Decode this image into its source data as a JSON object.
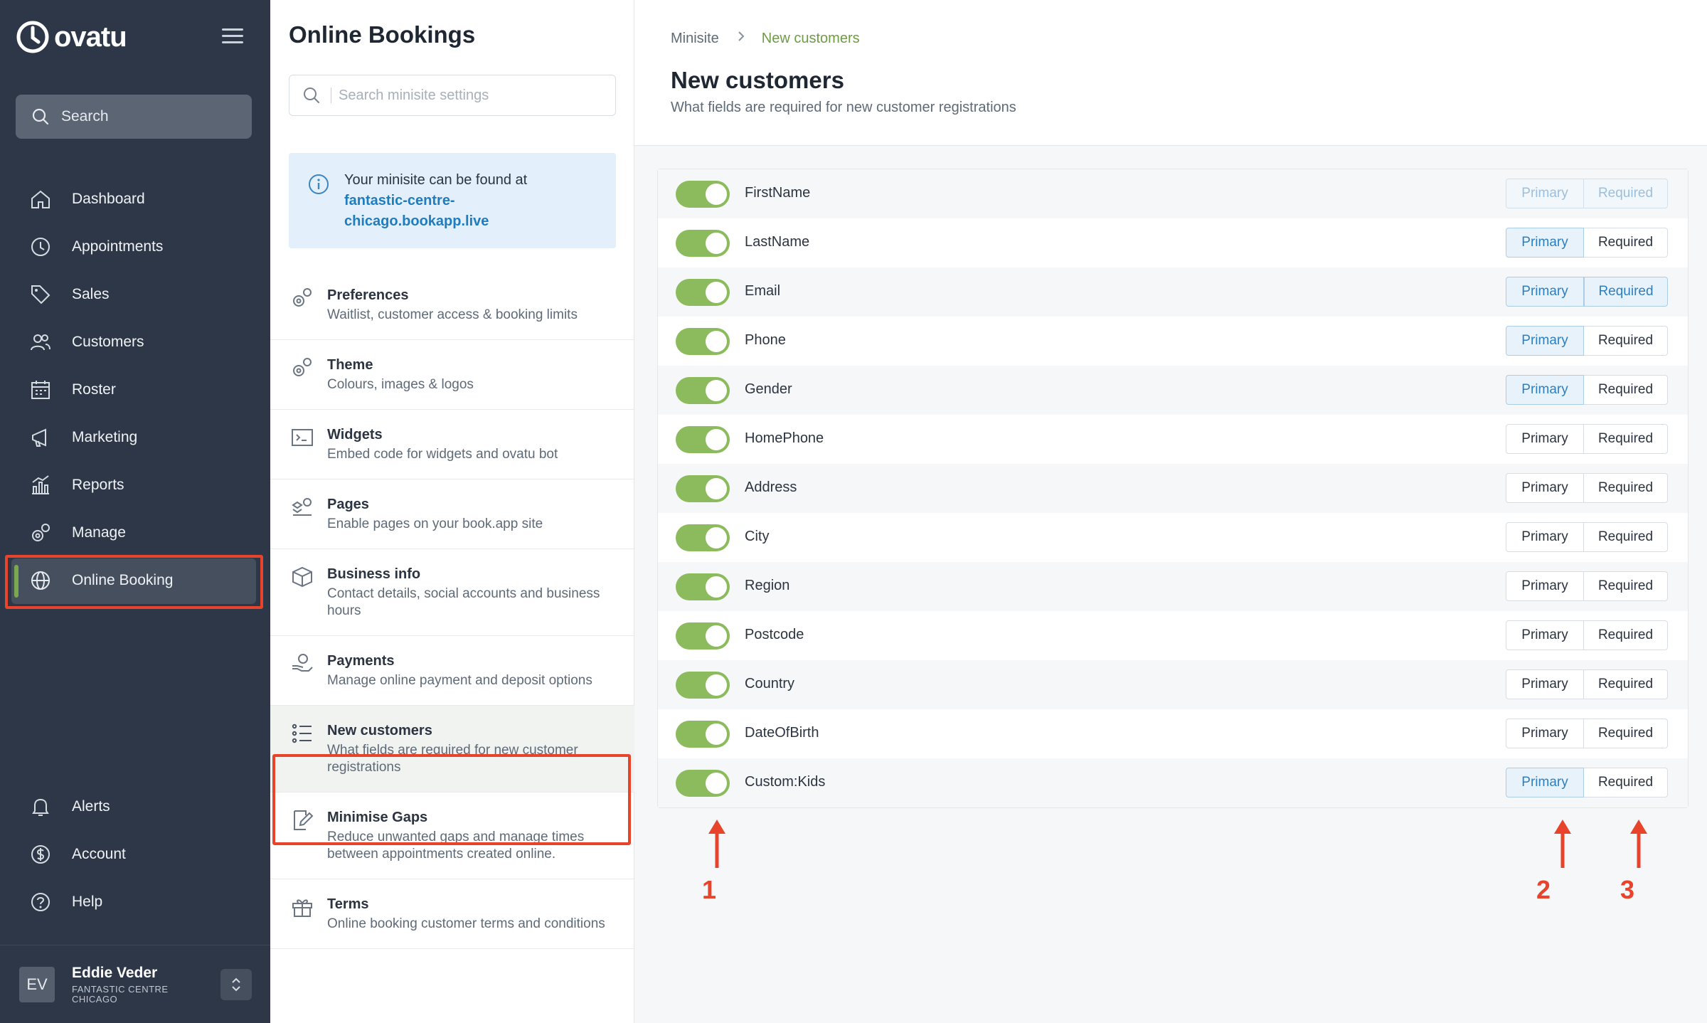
{
  "app": {
    "logo_text": "ovatu"
  },
  "sidebar": {
    "search_label": "Search",
    "items": [
      {
        "label": "Dashboard",
        "icon": "home-icon"
      },
      {
        "label": "Appointments",
        "icon": "clock-icon"
      },
      {
        "label": "Sales",
        "icon": "tag-icon"
      },
      {
        "label": "Customers",
        "icon": "users-icon"
      },
      {
        "label": "Roster",
        "icon": "calendar-icon"
      },
      {
        "label": "Marketing",
        "icon": "megaphone-icon"
      },
      {
        "label": "Reports",
        "icon": "bar-chart-icon"
      },
      {
        "label": "Manage",
        "icon": "gear-icon"
      },
      {
        "label": "Online Booking",
        "icon": "globe-icon",
        "active": true
      }
    ],
    "bottom_items": [
      {
        "label": "Alerts",
        "icon": "bell-icon"
      },
      {
        "label": "Account",
        "icon": "dollar-circle-icon"
      },
      {
        "label": "Help",
        "icon": "question-circle-icon"
      }
    ],
    "user": {
      "initials": "EV",
      "name": "Eddie Veder",
      "org": "FANTASTIC CENTRE CHICAGO"
    }
  },
  "middle": {
    "title": "Online Bookings",
    "search_placeholder": "Search minisite settings",
    "info_text": "Your minisite can be found at",
    "info_link": "fantastic-centre-chicago.bookapp.live",
    "info_link_line1": "fantastic-centre-",
    "info_link_line2": "chicago.bookapp.live",
    "settings": [
      {
        "title": "Preferences",
        "desc": "Waitlist, customer access & booking limits",
        "icon": "gears-icon"
      },
      {
        "title": "Theme",
        "desc": "Colours, images & logos",
        "icon": "palette-gear-icon"
      },
      {
        "title": "Widgets",
        "desc": "Embed code for widgets and ovatu bot",
        "icon": "terminal-icon"
      },
      {
        "title": "Pages",
        "desc": "Enable pages on your book.app site",
        "icon": "page-gear-icon"
      },
      {
        "title": "Business info",
        "desc": "Contact details, social accounts and business hours",
        "icon": "box-icon"
      },
      {
        "title": "Payments",
        "desc": "Manage online payment and deposit options",
        "icon": "money-hand-icon"
      },
      {
        "title": "New customers",
        "desc": "What fields are required for new customer registrations",
        "icon": "list-icon",
        "active": true
      },
      {
        "title": "Minimise Gaps",
        "desc": "Reduce unwanted gaps and manage times between appointments created online.",
        "icon": "edit-icon"
      },
      {
        "title": "Terms",
        "desc": "Online booking customer terms and conditions",
        "icon": "gift-icon"
      }
    ]
  },
  "main": {
    "breadcrumb": {
      "root": "Minisite",
      "current": "New customers"
    },
    "title": "New customers",
    "subtitle": "What fields are required for new customer registrations",
    "primary_label": "Primary",
    "required_label": "Required",
    "fields": [
      {
        "name": "FirstName",
        "enabled": true,
        "primary": "locked",
        "required": "locked"
      },
      {
        "name": "LastName",
        "enabled": true,
        "primary": "on",
        "required": "off"
      },
      {
        "name": "Email",
        "enabled": true,
        "primary": "on",
        "required": "on"
      },
      {
        "name": "Phone",
        "enabled": true,
        "primary": "on",
        "required": "off"
      },
      {
        "name": "Gender",
        "enabled": true,
        "primary": "on",
        "required": "off"
      },
      {
        "name": "HomePhone",
        "enabled": true,
        "primary": "off",
        "required": "off"
      },
      {
        "name": "Address",
        "enabled": true,
        "primary": "off",
        "required": "off"
      },
      {
        "name": "City",
        "enabled": true,
        "primary": "off",
        "required": "off"
      },
      {
        "name": "Region",
        "enabled": true,
        "primary": "off",
        "required": "off"
      },
      {
        "name": "Postcode",
        "enabled": true,
        "primary": "off",
        "required": "off"
      },
      {
        "name": "Country",
        "enabled": true,
        "primary": "off",
        "required": "off"
      },
      {
        "name": "DateOfBirth",
        "enabled": true,
        "primary": "off",
        "required": "off"
      },
      {
        "name": "Custom:Kids",
        "enabled": true,
        "primary": "on",
        "required": "off"
      }
    ]
  },
  "annotations": {
    "labels": [
      "1",
      "2",
      "3"
    ],
    "color": "#e8432b"
  },
  "colors": {
    "accent_green": "#7aa84f",
    "toggle_green": "#8bbb5c",
    "link_blue": "#1f7cbf",
    "highlight_red": "#e8432b"
  }
}
